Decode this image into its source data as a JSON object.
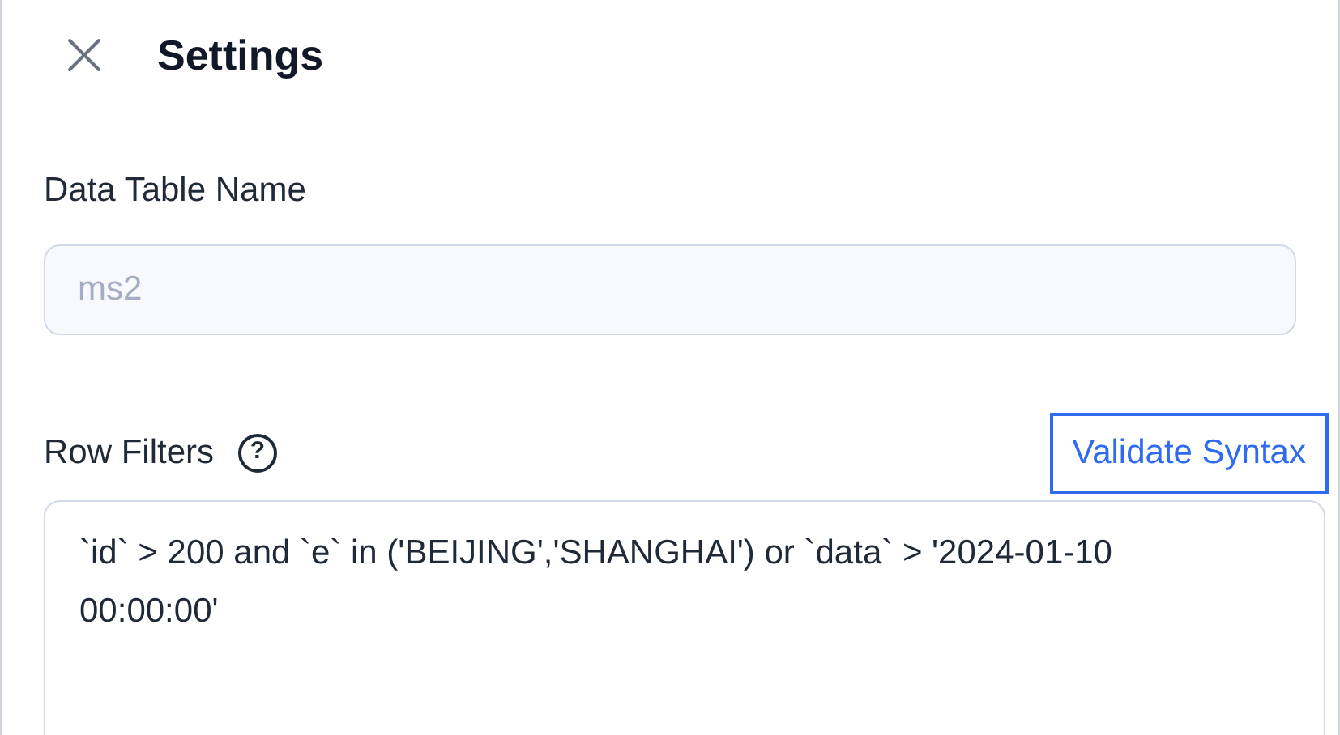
{
  "header": {
    "title": "Settings"
  },
  "table_name": {
    "label": "Data Table Name",
    "value": "ms2",
    "disabled": true
  },
  "row_filters": {
    "label": "Row Filters",
    "help_icon": "?",
    "validate_button": "Validate Syntax",
    "value": "`id` > 200 and `e` in ('BEIJING','SHANGHAI') or `data` > '2024-01-10 00:00:00'"
  }
}
